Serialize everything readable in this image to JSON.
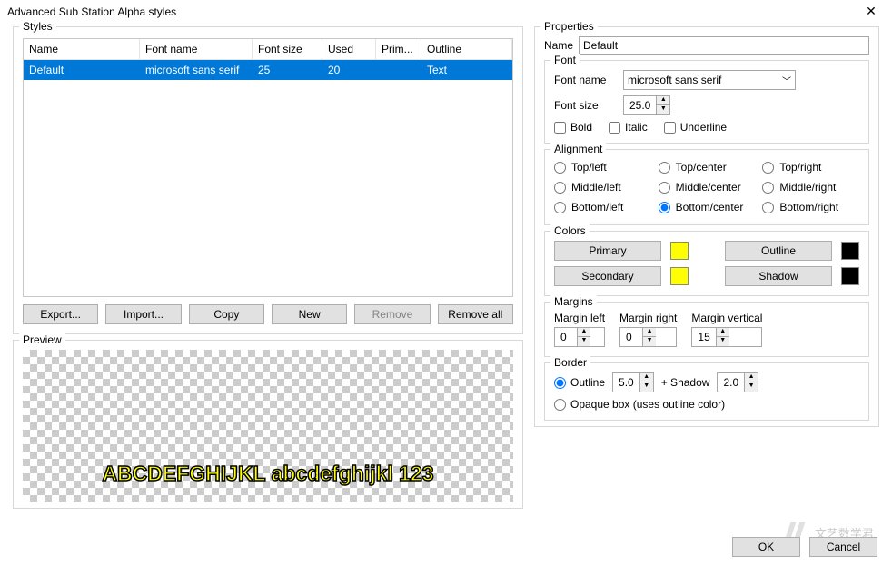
{
  "window": {
    "title": "Advanced Sub Station Alpha styles"
  },
  "styles": {
    "label": "Styles",
    "columns": {
      "name": "Name",
      "font_name": "Font name",
      "font_size": "Font size",
      "used": "Used",
      "primary": "Prim...",
      "outline": "Outline"
    },
    "rows": [
      {
        "name": "Default",
        "font_name": "microsoft sans serif",
        "font_size": "25",
        "used": "20",
        "primary": "",
        "outline": "Text"
      }
    ],
    "buttons": {
      "export": "Export...",
      "import": "Import...",
      "copy": "Copy",
      "new": "New",
      "remove": "Remove",
      "remove_all": "Remove all"
    }
  },
  "preview": {
    "label": "Preview",
    "sample": "ABCDEFGHIJKL abcdefghijkl 123"
  },
  "props": {
    "label": "Properties",
    "name_label": "Name",
    "name_value": "Default",
    "font": {
      "label": "Font",
      "name_label": "Font name",
      "name_value": "microsoft sans serif",
      "size_label": "Font size",
      "size_value": "25.0",
      "bold": "Bold",
      "italic": "Italic",
      "underline": "Underline"
    },
    "alignment": {
      "label": "Alignment",
      "tl": "Top/left",
      "tc": "Top/center",
      "tr": "Top/right",
      "ml": "Middle/left",
      "mc": "Middle/center",
      "mr": "Middle/right",
      "bl": "Bottom/left",
      "bc": "Bottom/center",
      "br": "Bottom/right",
      "selected": "bc"
    },
    "colors": {
      "label": "Colors",
      "primary": "Primary",
      "secondary": "Secondary",
      "outline": "Outline",
      "shadow": "Shadow",
      "primary_color": "#ffff00",
      "secondary_color": "#ffff00",
      "outline_color": "#000000",
      "shadow_color": "#000000"
    },
    "margins": {
      "label": "Margins",
      "left_label": "Margin left",
      "right_label": "Margin right",
      "vertical_label": "Margin vertical",
      "left": "0",
      "right": "0",
      "vertical": "15"
    },
    "border": {
      "label": "Border",
      "outline_label": "Outline",
      "outline_value": "5.0",
      "shadow_label": "+ Shadow",
      "shadow_value": "2.0",
      "opaque": "Opaque box (uses outline color)",
      "mode": "outline"
    }
  },
  "footer": {
    "ok": "OK",
    "cancel": "Cancel"
  },
  "watermark": "文艺数学君"
}
